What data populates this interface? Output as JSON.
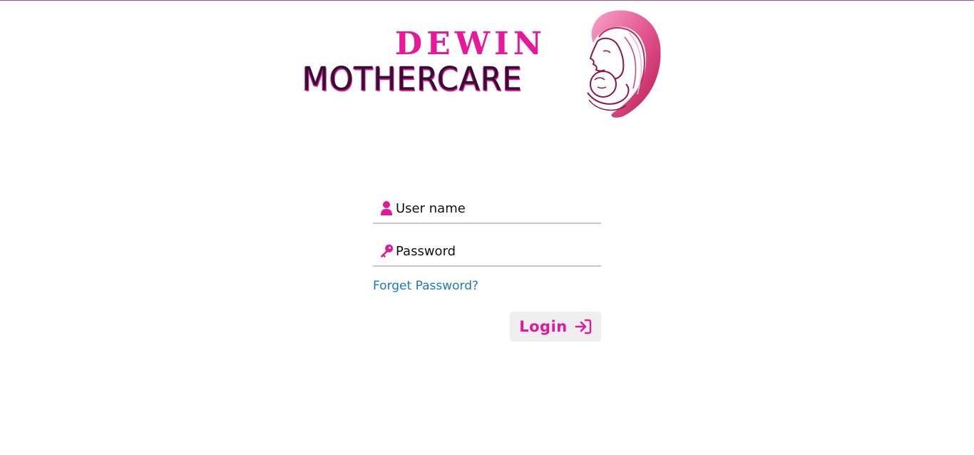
{
  "logo": {
    "line1": "DEWIN",
    "line2": "MOTHERCARE"
  },
  "login_form": {
    "username": {
      "placeholder": "User name",
      "value": "",
      "icon": "user-icon"
    },
    "password": {
      "placeholder": "Password",
      "value": "",
      "icon": "key-icon"
    },
    "forgot_label": "Forget Password?",
    "login_label": "Login",
    "login_icon": "sign-in-arrow-icon"
  },
  "colors": {
    "brand_pink": "#e8189a",
    "link_blue": "#1a76c9",
    "top_border": "#9b4e9f"
  }
}
